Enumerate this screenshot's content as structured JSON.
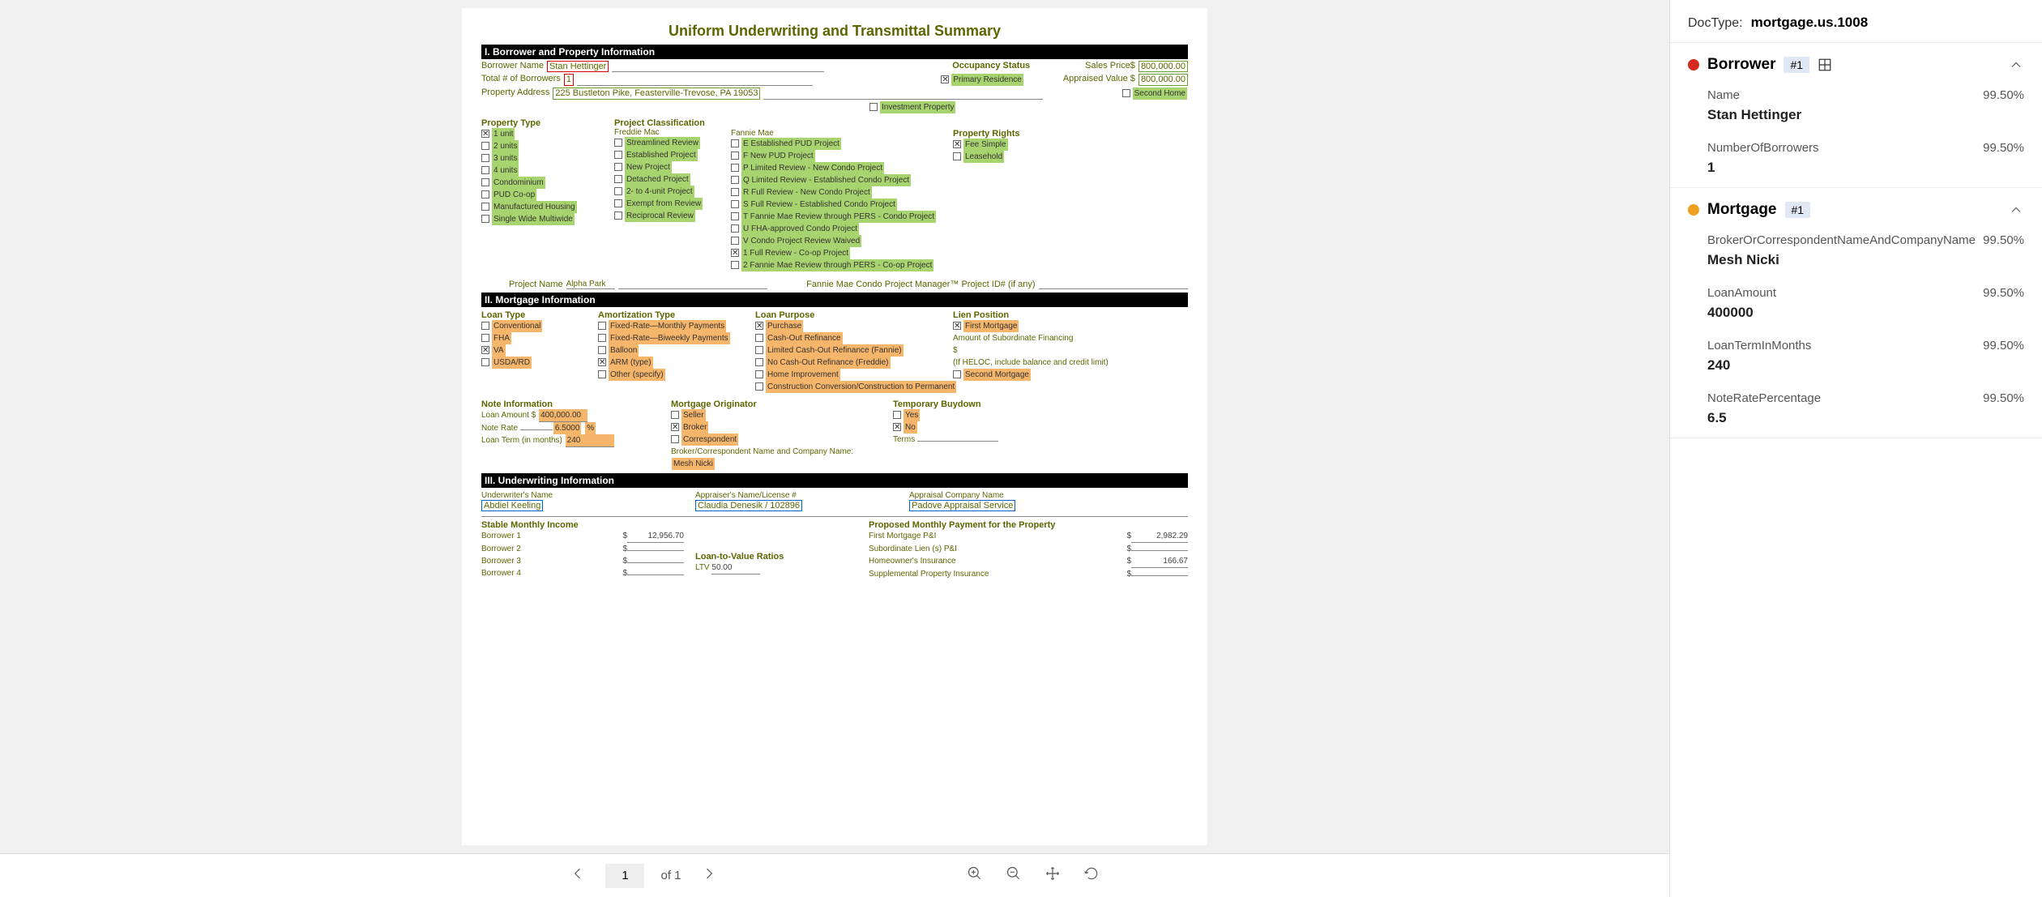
{
  "toolbar": {
    "page": "1",
    "of_label": "of 1"
  },
  "doctype": {
    "label": "DocType:",
    "value": "mortgage.us.1008"
  },
  "entities": {
    "borrower": {
      "title": "Borrower",
      "badge": "#1",
      "fields": [
        {
          "label": "Name",
          "conf": "99.50%",
          "value": "Stan Hettinger"
        },
        {
          "label": "NumberOfBorrowers",
          "conf": "99.50%",
          "value": "1"
        }
      ]
    },
    "mortgage": {
      "title": "Mortgage",
      "badge": "#1",
      "fields": [
        {
          "label": "BrokerOrCorrespondentNameAndCompanyName",
          "conf": "99.50%",
          "value": "Mesh Nicki"
        },
        {
          "label": "LoanAmount",
          "conf": "99.50%",
          "value": "400000"
        },
        {
          "label": "LoanTermInMonths",
          "conf": "99.50%",
          "value": "240"
        },
        {
          "label": "NoteRatePercentage",
          "conf": "99.50%",
          "value": "6.5"
        }
      ]
    }
  },
  "doc": {
    "title": "Uniform Underwriting and Transmittal Summary",
    "s1": {
      "title": "I. Borrower and Property Information",
      "borrower_name_label": "Borrower Name",
      "borrower_name": "Stan Hettinger",
      "total_borrowers_label": "Total # of Borrowers",
      "total_borrowers": "1",
      "address_label": "Property Address",
      "address": "225 Bustleton Pike, Feasterville-Trevose, PA 19053",
      "occupancy_label": "Occupancy Status",
      "occupancy": [
        "Primary Residence",
        "Second Home",
        "Investment Property"
      ],
      "sales_price_label": "Sales Price$",
      "sales_price": "800,000.00",
      "appraised_label": "Appraised Value $",
      "appraised": "800,000.00",
      "prop_type_label": "Property Type",
      "prop_types": [
        "1 unit",
        "2 units",
        "3 units",
        "4 units",
        "Condominium",
        "PUD   Co-op",
        "Manufactured Housing",
        "Single Wide   Multiwide"
      ],
      "proj_class_label": "Project Classification",
      "freddie_label": "Freddie Mac",
      "freddie": [
        "Streamlined Review",
        "Established Project",
        "New Project",
        "Detached Project",
        "2- to 4-unit Project",
        "Exempt from Review",
        "Reciprocal Review"
      ],
      "fannie_label": "Fannie Mae",
      "fannie": [
        "E Established PUD Project",
        "F New PUD Project",
        "P Limited Review - New Condo Project",
        "Q Limited Review - Established Condo Project",
        "R Full Review - New Condo Project",
        "S Full Review - Established Condo Project",
        "T Fannie Mae Review through PERS - Condo Project",
        "U FHA-approved Condo Project",
        "V Condo Project Review Waived",
        "1 Full Review - Co-op Project",
        "2 Fannie Mae Review through PERS - Co-op Project"
      ],
      "rights_label": "Property Rights",
      "rights": [
        "Fee Simple",
        "Leasehold"
      ],
      "project_name_label": "Project Name",
      "project_name": "Alpha Park",
      "fannie_id_label": "Fannie Mae Condo Project Manager™ Project ID# (if any)"
    },
    "s2": {
      "title": "II. Mortgage Information",
      "loan_type_label": "Loan Type",
      "loan_types": [
        "Conventional",
        "FHA",
        "VA",
        "USDA/RD"
      ],
      "amort_label": "Amortization Type",
      "amort": [
        "Fixed-Rate—Monthly Payments",
        "Fixed-Rate—Biweekly Payments",
        "Balloon",
        "ARM (type)",
        "Other (specify)"
      ],
      "purpose_label": "Loan Purpose",
      "purpose": [
        "Purchase",
        "Cash-Out Refinance",
        "Limited Cash-Out Refinance (Fannie)",
        "No Cash-Out Refinance (Freddie)",
        "Home Improvement",
        "Construction Conversion/Construction to Permanent"
      ],
      "lien_label": "Lien Position",
      "lien": [
        "First Mortgage",
        "Second Mortgage"
      ],
      "sub_fin": "Amount of Subordinate Financing",
      "sub_fin2": "$",
      "heloc": "(If HELOC, include balance and credit limit)",
      "note_info": "Note Information",
      "loan_amt_label": "Loan Amount $",
      "loan_amt": "400,000.00",
      "note_rate_label": "Note Rate",
      "note_rate": "6.5000",
      "pct": "%",
      "term_label": "Loan Term (in months)",
      "term": "240",
      "orig_label": "Mortgage Originator",
      "orig": [
        "Seller",
        "Broker",
        "Correspondent"
      ],
      "bc_label": "Broker/Correspondent Name and Company Name:",
      "bc_name": "Mesh Nicki",
      "buydown_label": "Temporary Buydown",
      "buydown": [
        "Yes",
        "No"
      ],
      "terms_label": "Terms"
    },
    "s3": {
      "title": "III. Underwriting Information",
      "uw_label": "Underwriter's Name",
      "uw": "Abdiel Keeling",
      "appr_label": "Appraiser's Name/License #",
      "appr": "Claudia Denesik / 102896",
      "co_label": "Appraisal Company Name",
      "co": "Padove Appraisal Service",
      "smi": "Stable Monthly Income",
      "pmp": "Proposed Monthly Payment for the Property",
      "b1": "Borrower 1",
      "b2": "Borrower 2",
      "b3": "Borrower 3",
      "b4": "Borrower 4",
      "inc1": "12,956.70",
      "ltv_label": "Loan-to-Value Ratios",
      "ltv": "LTV",
      "ltv_v": "50.00",
      "fm": "First Mortgage P&I",
      "sl": "Subordinate Lien (s) P&I",
      "hi": "Homeowner's Insurance",
      "spi": "Supplemental Property Insurance",
      "p1": "2,982.29",
      "p3": "166.67"
    }
  }
}
